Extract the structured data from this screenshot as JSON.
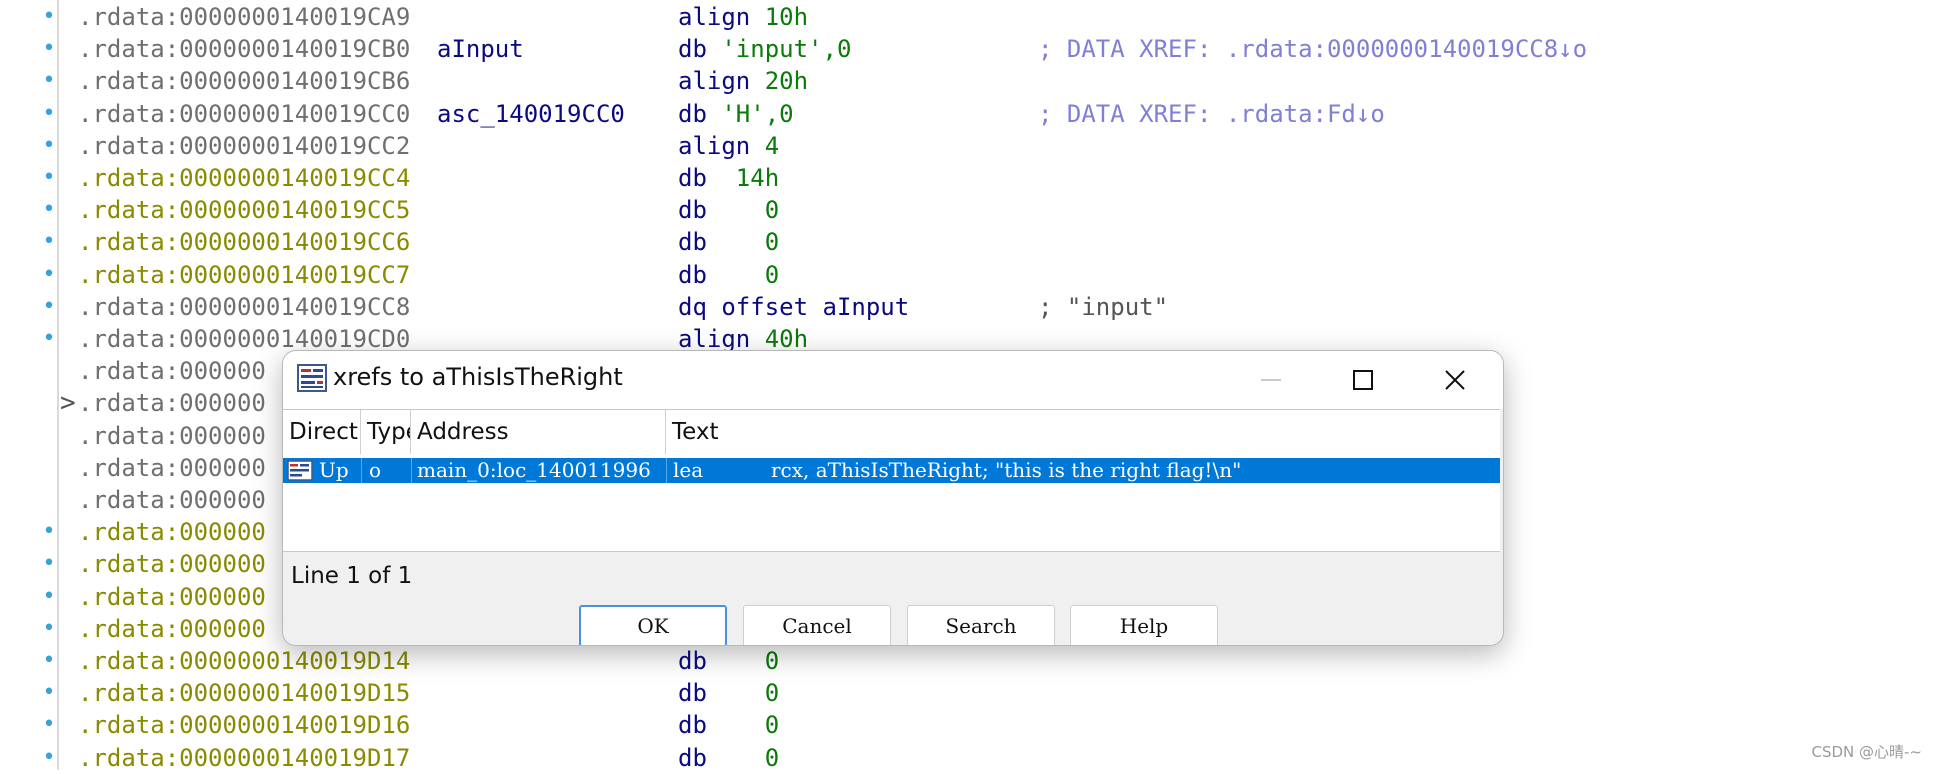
{
  "listing": {
    "rows": [
      {
        "marker": "•",
        "addr": ".rdata:0000000140019CA9",
        "addr_color": "gray",
        "label": "",
        "op": "align",
        "args": "10h",
        "args_kind": "num",
        "comment": ""
      },
      {
        "marker": "•",
        "addr": ".rdata:0000000140019CB0",
        "addr_color": "gray",
        "label": "aInput",
        "op": "db",
        "args": "'input',0",
        "args_kind": "str",
        "comment": "; DATA XREF: .rdata:0000000140019CC8↓o"
      },
      {
        "marker": "•",
        "addr": ".rdata:0000000140019CB6",
        "addr_color": "gray",
        "label": "",
        "op": "align",
        "args": "20h",
        "args_kind": "num",
        "comment": ""
      },
      {
        "marker": "•",
        "addr": ".rdata:0000000140019CC0",
        "addr_color": "gray",
        "label": "asc_140019CC0",
        "op": "db",
        "args": "'H',0",
        "args_kind": "str",
        "comment": "; DATA XREF: .rdata:Fd↓o"
      },
      {
        "marker": "•",
        "addr": ".rdata:0000000140019CC2",
        "addr_color": "gray",
        "label": "",
        "op": "align",
        "args": "4",
        "args_kind": "num",
        "comment": ""
      },
      {
        "marker": "•",
        "addr": ".rdata:0000000140019CC4",
        "addr_color": "olive",
        "label": "",
        "op": "db",
        "args": " 14h",
        "args_kind": "num",
        "comment": ""
      },
      {
        "marker": "•",
        "addr": ".rdata:0000000140019CC5",
        "addr_color": "olive",
        "label": "",
        "op": "db",
        "args": "   0",
        "args_kind": "num",
        "comment": ""
      },
      {
        "marker": "•",
        "addr": ".rdata:0000000140019CC6",
        "addr_color": "olive",
        "label": "",
        "op": "db",
        "args": "   0",
        "args_kind": "num",
        "comment": ""
      },
      {
        "marker": "•",
        "addr": ".rdata:0000000140019CC7",
        "addr_color": "olive",
        "label": "",
        "op": "db",
        "args": "   0",
        "args_kind": "num",
        "comment": ""
      },
      {
        "marker": "•",
        "addr": ".rdata:0000000140019CC8",
        "addr_color": "gray",
        "label": "",
        "op": "dq offset",
        "args": "aInput",
        "args_kind": "name",
        "comment": "; \"input\""
      },
      {
        "marker": "•",
        "addr": ".rdata:0000000140019CD0",
        "addr_color": "gray",
        "label": "",
        "op": "align",
        "args": "40h",
        "args_kind": "num",
        "comment": ""
      },
      {
        "marker": "",
        "addr": ".rdata:000000",
        "addr_color": "gray",
        "label": "",
        "op": "",
        "args": "",
        "args_kind": "num",
        "comment": ""
      },
      {
        "marker": ">",
        "addr": ".rdata:000000",
        "addr_color": "gray",
        "label": "",
        "op": "",
        "args": "",
        "args_kind": "num",
        "comment": ""
      },
      {
        "marker": "",
        "addr": ".rdata:000000",
        "addr_color": "gray",
        "label": "",
        "op": "",
        "args": "",
        "args_kind": "num",
        "comment": ""
      },
      {
        "marker": "",
        "addr": ".rdata:000000",
        "addr_color": "gray",
        "label": "",
        "op": "",
        "args": "",
        "args_kind": "num",
        "comment": ""
      },
      {
        "marker": "",
        "addr": ".rdata:000000",
        "addr_color": "gray",
        "label": "",
        "op": "",
        "args": "",
        "args_kind": "num",
        "comment": ""
      },
      {
        "marker": "•",
        "addr": ".rdata:000000",
        "addr_color": "olive",
        "label": "",
        "op": "",
        "args": "",
        "args_kind": "num",
        "comment": ""
      },
      {
        "marker": "•",
        "addr": ".rdata:000000",
        "addr_color": "olive",
        "label": "",
        "op": "",
        "args": "",
        "args_kind": "num",
        "comment": ""
      },
      {
        "marker": "•",
        "addr": ".rdata:000000",
        "addr_color": "olive",
        "label": "",
        "op": "",
        "args": "",
        "args_kind": "num",
        "comment": ""
      },
      {
        "marker": "•",
        "addr": ".rdata:000000",
        "addr_color": "olive",
        "label": "",
        "op": "",
        "args": "",
        "args_kind": "num",
        "comment": ""
      },
      {
        "marker": "•",
        "addr": ".rdata:0000000140019D14",
        "addr_color": "olive",
        "label": "",
        "op": "db",
        "args": "   0",
        "args_kind": "num",
        "comment": ""
      },
      {
        "marker": "•",
        "addr": ".rdata:0000000140019D15",
        "addr_color": "olive",
        "label": "",
        "op": "db",
        "args": "   0",
        "args_kind": "num",
        "comment": ""
      },
      {
        "marker": "•",
        "addr": ".rdata:0000000140019D16",
        "addr_color": "olive",
        "label": "",
        "op": "db",
        "args": "   0",
        "args_kind": "num",
        "comment": ""
      },
      {
        "marker": "•",
        "addr": ".rdata:0000000140019D17",
        "addr_color": "olive",
        "label": "",
        "op": "db",
        "args": "   0",
        "args_kind": "num",
        "comment": ""
      }
    ]
  },
  "dialog": {
    "title": "xrefs to aThisIsTheRight",
    "columns": {
      "direction": "Direction",
      "type": "Type",
      "address": "Address",
      "text": "Text"
    },
    "selected_row": {
      "direction": "Up",
      "type": "o",
      "address": "main_0:loc_140011996",
      "mnemonic": "lea",
      "operands": "rcx, aThisIsTheRight; \"this is the right flag!\\n\""
    },
    "status": "Line 1 of 1",
    "buttons": {
      "ok": "OK",
      "cancel": "Cancel",
      "search": "Search",
      "help": "Help"
    }
  },
  "watermark": "CSDN @心晴-~",
  "colors": {
    "selection": "#0078d7",
    "marker_blue": "#3aa0e0",
    "addr_gray": "#6f6f6f",
    "addr_olive": "#8a8a00",
    "keyword_navy": "#0a0a80",
    "number_green": "#0a7a0a",
    "comment_blue": "#7f7fd6"
  }
}
